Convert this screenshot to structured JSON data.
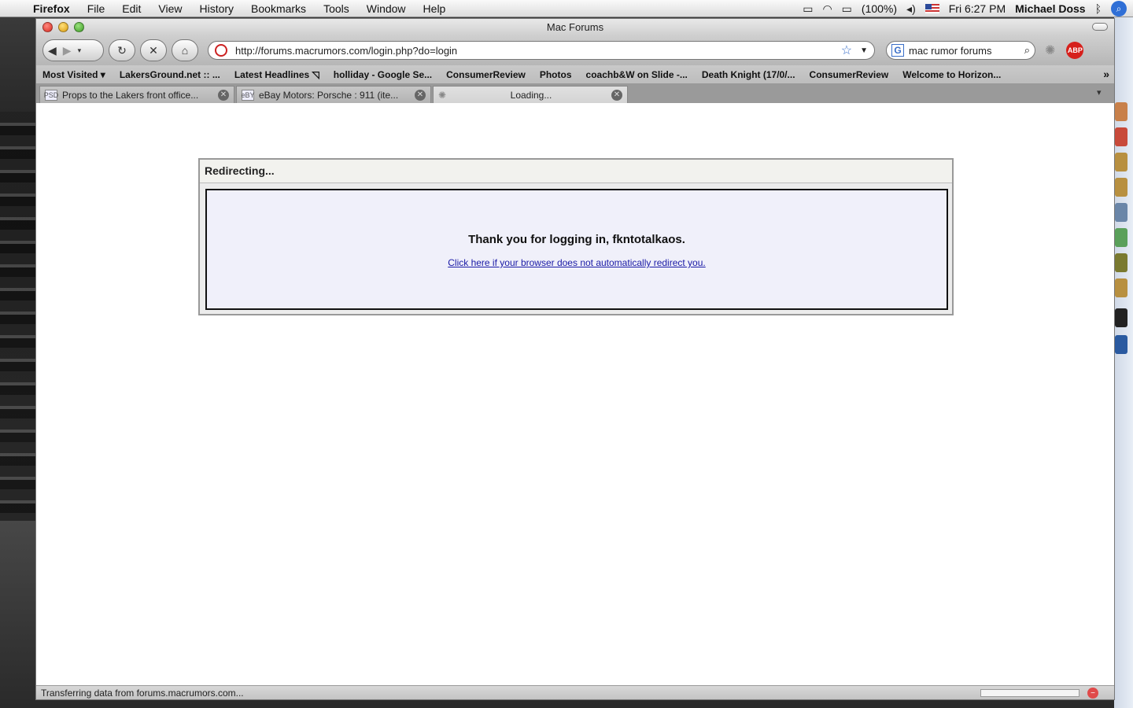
{
  "menubar": {
    "apple_icon": "apple-icon",
    "app_name": "Firefox",
    "menus": [
      "File",
      "Edit",
      "View",
      "History",
      "Bookmarks",
      "Tools",
      "Window",
      "Help"
    ],
    "battery": "(100%)",
    "clock": "Fri 6:27 PM",
    "user": "Michael Doss"
  },
  "window": {
    "title": "Mac Forums"
  },
  "navbar": {
    "url": "http://forums.macrumors.com/login.php?do=login",
    "search_value": "mac rumor forums",
    "abp_label": "ABP"
  },
  "bookmarks": [
    "Most Visited ▾",
    "LakersGround.net :: ...",
    "Latest Headlines ◹",
    "holliday - Google Se...",
    "ConsumerReview",
    "Photos",
    "coachb&W on Slide -...",
    "Death Knight (17/0/...",
    "ConsumerReview",
    "Welcome to Horizon..."
  ],
  "tabs": [
    {
      "favicon": "PSD",
      "title": "Props to the Lakers front office..."
    },
    {
      "favicon": "eBY",
      "title": "eBay Motors: Porsche : 911 (ite..."
    },
    {
      "favicon": "",
      "title": "Loading..."
    }
  ],
  "page": {
    "heading": "Redirecting...",
    "message": "Thank you for logging in, fkntotalkaos.",
    "link": "Click here if your browser does not automatically redirect you."
  },
  "status": {
    "text": "Transferring data from forums.macrumors.com..."
  },
  "colors": {
    "link": "#1a1aa6",
    "panel_body": "#f0f0fa",
    "abp_red": "#d6201c"
  }
}
